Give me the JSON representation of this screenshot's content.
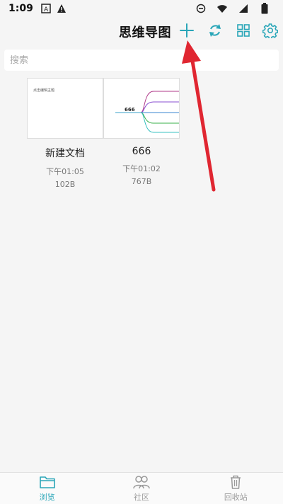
{
  "status_bar": {
    "time": "1:09",
    "icons": [
      "font-icon",
      "notification-warning-icon",
      "dnd-icon",
      "wifi-icon",
      "signal-icon",
      "battery-icon"
    ]
  },
  "header": {
    "title": "思维导图",
    "actions": [
      "add-icon",
      "sync-icon",
      "grid-view-icon",
      "settings-icon"
    ],
    "accent_color": "#2aa6b8"
  },
  "search": {
    "placeholder": "搜索"
  },
  "files": [
    {
      "name": "新建文档",
      "time": "下午01:05",
      "size": "102B",
      "thumb_text": "点击编辑主题"
    },
    {
      "name": "666",
      "time": "下午01:02",
      "size": "767B",
      "thumb_text": "666"
    }
  ],
  "bottom_nav": {
    "items": [
      {
        "label": "浏览",
        "icon": "folder-icon",
        "active": true
      },
      {
        "label": "社区",
        "icon": "people-icon",
        "active": false
      },
      {
        "label": "回收站",
        "icon": "trash-icon",
        "active": false
      }
    ]
  },
  "annotation_color": "#e02631"
}
